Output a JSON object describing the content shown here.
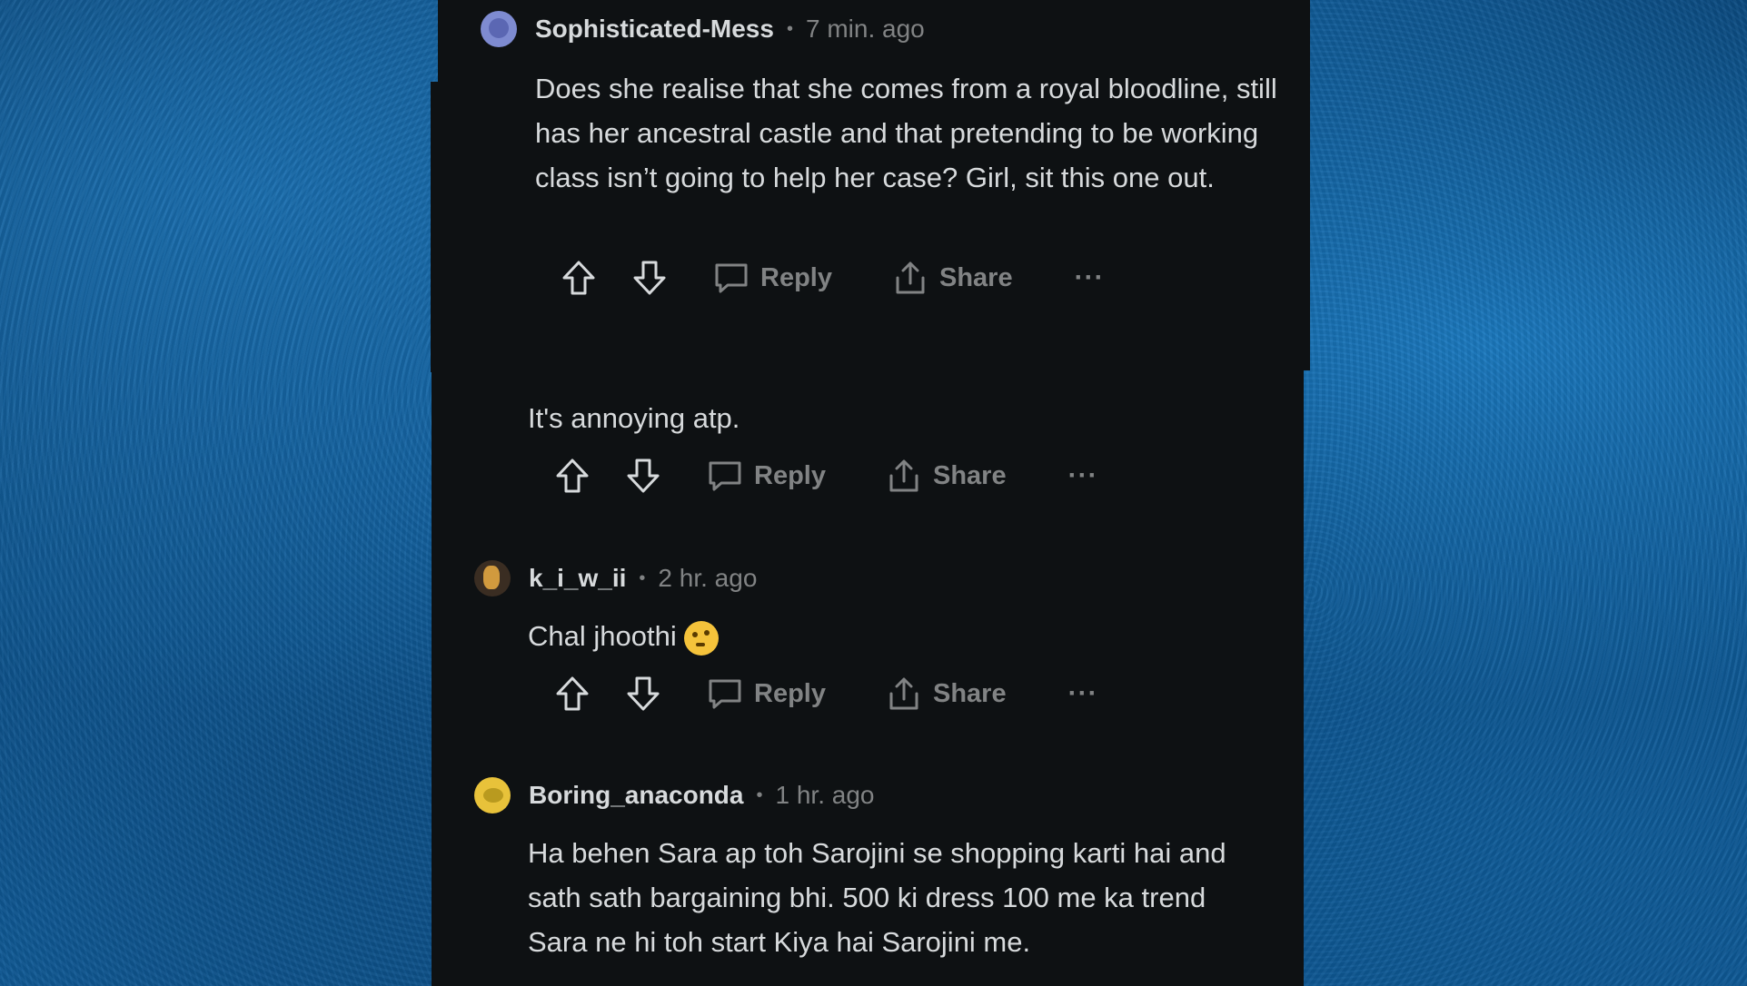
{
  "comments": [
    {
      "username": "Sophisticated-Mess",
      "time": "7 min. ago",
      "body": "Does she realise that she comes from a royal bloodline, still has her ancestral castle and that pretending to be working class isn’t going to help her case? Girl, sit this one out.",
      "reply_label": "Reply",
      "share_label": "Share",
      "more_label": "···"
    },
    {
      "username": "",
      "time": "",
      "body": "It's annoying atp.",
      "reply_label": "Reply",
      "share_label": "Share",
      "more_label": "···"
    },
    {
      "username": "k_i_w_ii",
      "time": "2 hr. ago",
      "body": "Chal jhoothi",
      "reply_label": "Reply",
      "share_label": "Share",
      "more_label": "···"
    },
    {
      "username": "Boring_anaconda",
      "time": "1 hr. ago",
      "body": "Ha behen Sara ap toh Sarojini se shopping karti hai and sath sath bargaining bhi. 500 ki dress 100 me ka trend Sara ne hi toh start Kiya hai Sarojini me."
    }
  ],
  "separator": "•",
  "colors": {
    "panel_bg": "#0e1113",
    "text": "#d7dadc",
    "muted": "#818384",
    "background_blue": "#1466a8"
  },
  "icons": [
    "upvote-icon",
    "downvote-icon",
    "reply-icon",
    "share-icon",
    "more-icon",
    "emoji-thinking-icon"
  ]
}
